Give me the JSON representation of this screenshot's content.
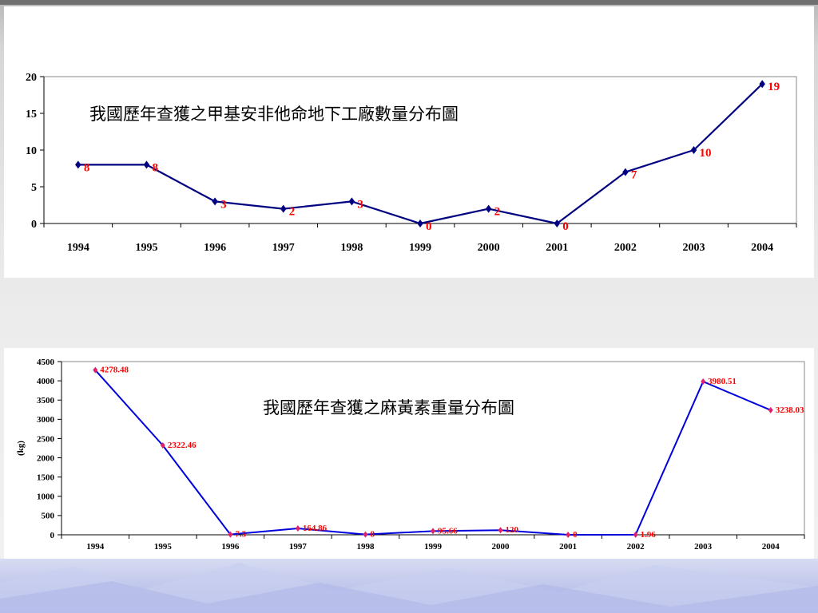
{
  "chart_data": [
    {
      "type": "line",
      "title": "我國歷年查獲之甲基安非他命地下工廠數量分布圖",
      "categories": [
        "1994",
        "1995",
        "1996",
        "1997",
        "1998",
        "1999",
        "2000",
        "2001",
        "2002",
        "2003",
        "2004"
      ],
      "series": [
        {
          "values": [
            8,
            8,
            3,
            2,
            3,
            0,
            2,
            0,
            7,
            10,
            19
          ],
          "labels": [
            "8",
            "8",
            "3",
            "2",
            "3",
            "0",
            "2",
            "0",
            "7",
            "10",
            "19"
          ]
        }
      ],
      "ylim": [
        0,
        20
      ],
      "yticks": [
        "0",
        "5",
        "10",
        "15",
        "20"
      ],
      "xlabel": "",
      "ylabel": "",
      "grid": false,
      "colors": {
        "line": "#000080",
        "label": "#ff0000"
      }
    },
    {
      "type": "line",
      "title": "我國歷年查獲之麻黃素重量分布圖",
      "categories": [
        "1994",
        "1995",
        "1996",
        "1997",
        "1998",
        "1999",
        "2000",
        "2001",
        "2002",
        "2003",
        "2004"
      ],
      "series": [
        {
          "values": [
            4278.48,
            2322.46,
            7.5,
            164.86,
            8,
            95.66,
            120,
            0,
            1.96,
            3980.51,
            3238.03
          ],
          "labels": [
            "4278.48",
            "2322.46",
            "7.5",
            "164.86",
            "8",
            "95.66",
            "120",
            "0",
            "1.96",
            "3980.51",
            "3238.03"
          ]
        }
      ],
      "ylim": [
        0,
        4500
      ],
      "yticks": [
        "0",
        "500",
        "1000",
        "1500",
        "2000",
        "2500",
        "3000",
        "3500",
        "4000",
        "4500"
      ],
      "xlabel": "",
      "ylabel": "(kg)",
      "grid": false,
      "colors": {
        "line": "#0000dd",
        "marker": "#e0206a",
        "label": "#ff0000"
      }
    }
  ]
}
